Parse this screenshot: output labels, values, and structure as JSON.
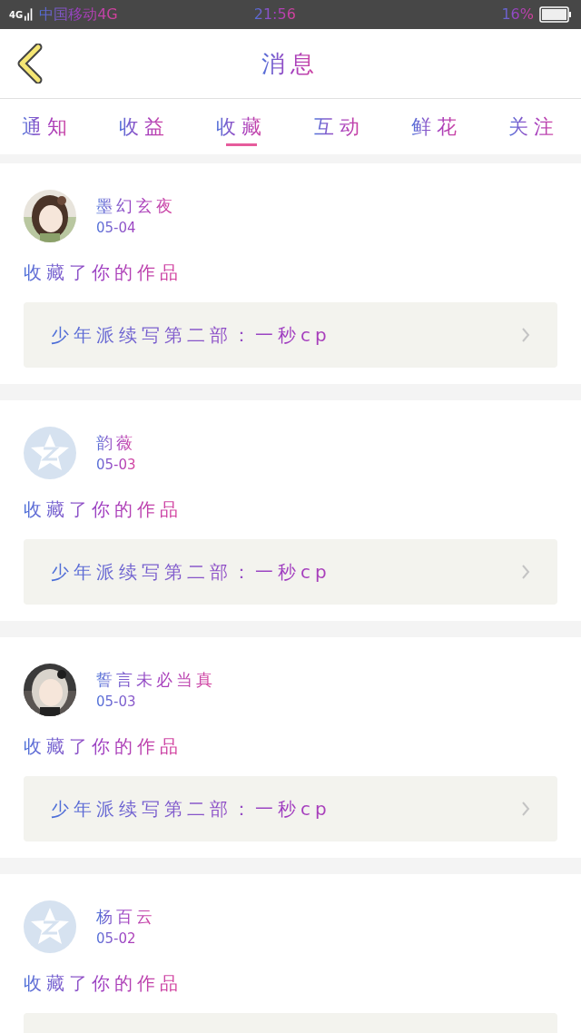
{
  "status_bar": {
    "network": "4G",
    "carrier": "中国移动4G",
    "time": "21:56",
    "battery": "16%"
  },
  "header": {
    "title": "消息"
  },
  "tabs": [
    {
      "label": "通知",
      "selected": false
    },
    {
      "label": "收益",
      "selected": false
    },
    {
      "label": "收藏",
      "selected": true
    },
    {
      "label": "互动",
      "selected": false
    },
    {
      "label": "鲜花",
      "selected": false
    },
    {
      "label": "关注",
      "selected": false
    }
  ],
  "items": [
    {
      "kind": "picture",
      "name": "墨幻玄夜",
      "date": "05-04",
      "action": "收藏了你的作品",
      "work": "少年派续写第二部：一秒cp"
    },
    {
      "kind": "default_avatar",
      "name": "韵薇",
      "date": "05-03",
      "action": "收藏了你的作品",
      "work": "少年派续写第二部：一秒cp"
    },
    {
      "kind": "picture",
      "name": "誓言未必当真",
      "date": "05-03",
      "action": "收藏了你的作品",
      "work": "少年派续写第二部：一秒cp"
    },
    {
      "kind": "default_avatar",
      "name": "杨百云",
      "date": "05-02",
      "action": "收藏了你的作品"
    }
  ]
}
